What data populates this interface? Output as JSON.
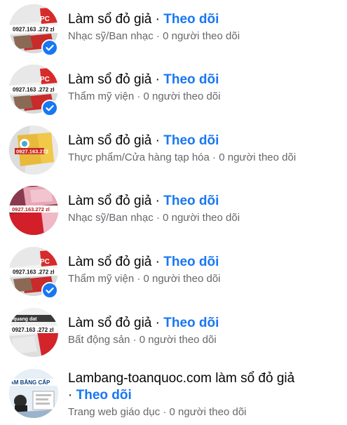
{
  "follow_label": "Theo dõi",
  "separator": "·",
  "rows": [
    {
      "name": "Làm sổ đỏ giả",
      "category": "Nhạc sỹ/Ban nhạc",
      "followers": "0 người theo dõi",
      "avatar_text": "0927.163 .272 zl",
      "avatar_badge_text": "PC",
      "verified": true
    },
    {
      "name": "Làm sổ đỏ giả",
      "category": "Thẩm mỹ viện",
      "followers": "0 người theo dõi",
      "avatar_text": "0927.163 .272 zl",
      "avatar_badge_text": "PC",
      "verified": true
    },
    {
      "name": "Làm sổ đỏ giả",
      "category": "Thực phẩm/Cửa hàng tạp hóa",
      "followers": "0 người theo dõi",
      "avatar_text": "0927.163.272",
      "verified": false
    },
    {
      "name": "Làm sổ đỏ giả",
      "category": "Nhạc sỹ/Ban nhạc",
      "followers": "0 người theo dõi",
      "avatar_text": "0927.163.272 zl",
      "verified": false
    },
    {
      "name": "Làm sổ đỏ giả",
      "category": "Thẩm mỹ viện",
      "followers": "0 người theo dõi",
      "avatar_text": "0927.163 .272 zl",
      "avatar_badge_text": "PC",
      "verified": true
    },
    {
      "name": "Làm sổ đỏ giả",
      "category": "Bất động sản",
      "followers": "0 người theo dõi",
      "avatar_text": "0927.163 .272 zl",
      "avatar_top_text": "quang dat",
      "verified": false
    },
    {
      "name": "Lambang-toanquoc.com làm sổ đỏ giả",
      "category": "Trang web giáo dục",
      "followers": "0 người theo dõi",
      "avatar_text": "AM BẰNG CẤP",
      "verified": false
    }
  ],
  "colors": {
    "link_blue": "#1877f2",
    "secondary_text": "#65676b",
    "primary_text": "#050505"
  },
  "icons": {
    "verified": "verified-check-icon"
  }
}
